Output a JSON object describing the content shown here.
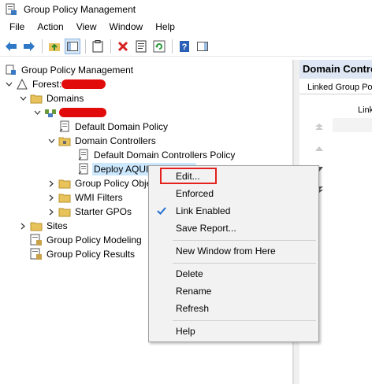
{
  "window": {
    "title": "Group Policy Management"
  },
  "menubar": {
    "items": [
      "File",
      "Action",
      "View",
      "Window",
      "Help"
    ]
  },
  "tree": {
    "root": "Group Policy Management",
    "forest_label": "Forest:",
    "domains": "Domains",
    "default_domain_policy": "Default Domain Policy",
    "domain_controllers": "Domain Controllers",
    "default_dc_policy": "Default Domain Controllers Policy",
    "deploy_gpo": "Deploy AQUI Agent MSI",
    "gpo_objects": "Group Policy Objects",
    "wmi_filters": "WMI Filters",
    "starter_gpos": "Starter GPOs",
    "sites": "Sites",
    "modeling": "Group Policy Modeling",
    "results": "Group Policy Results"
  },
  "right_pane": {
    "header": "Domain Controllers",
    "tab": "Linked Group Policy Objects",
    "column": "Link Order"
  },
  "context_menu": {
    "items": [
      "Edit...",
      "Enforced",
      "Link Enabled",
      "Save Report...",
      "New Window from Here",
      "Delete",
      "Rename",
      "Refresh",
      "Help"
    ],
    "checked_item": "Link Enabled",
    "highlighted_item": "Edit..."
  },
  "colors": {
    "selection": "#cce8ff",
    "header_bg": "#dde6f2",
    "highlight_border": "#e3211e",
    "redaction": "#e10b0b"
  }
}
